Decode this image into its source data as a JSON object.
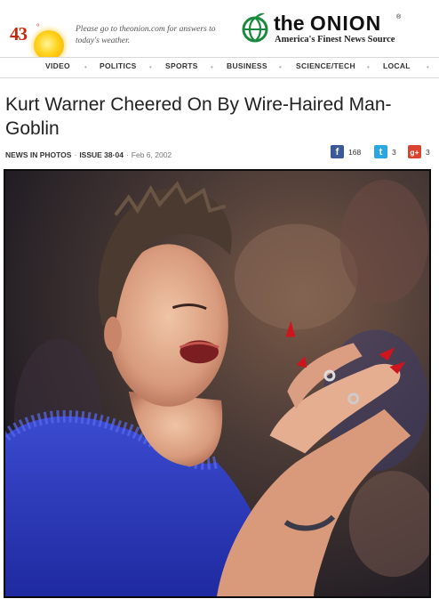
{
  "weather": {
    "temperature": "43",
    "degree_symbol": "°",
    "note": "Please go to theonion.com for answers to today's weather."
  },
  "logo": {
    "word_the": "the",
    "word_onion": "ONION",
    "registered": "®",
    "tagline": "America's Finest News Source",
    "brand_color": "#1c8a3e"
  },
  "nav": {
    "items": [
      "VIDEO",
      "POLITICS",
      "SPORTS",
      "BUSINESS",
      "SCIENCE/TECH",
      "LOCAL"
    ]
  },
  "article": {
    "headline": "Kurt Warner Cheered On By Wire-Haired Man-Goblin",
    "section": "NEWS IN PHOTOS",
    "separator": "·",
    "issue": "ISSUE 38·04",
    "date": "Feb 6, 2002"
  },
  "share": {
    "facebook": {
      "icon": "f",
      "count": "168",
      "color": "#3b5998"
    },
    "twitter": {
      "icon": "t",
      "count": "3",
      "color": "#2aa7e0"
    },
    "googleplus": {
      "icon": "g+",
      "count": "3",
      "color": "#d9432f"
    }
  }
}
